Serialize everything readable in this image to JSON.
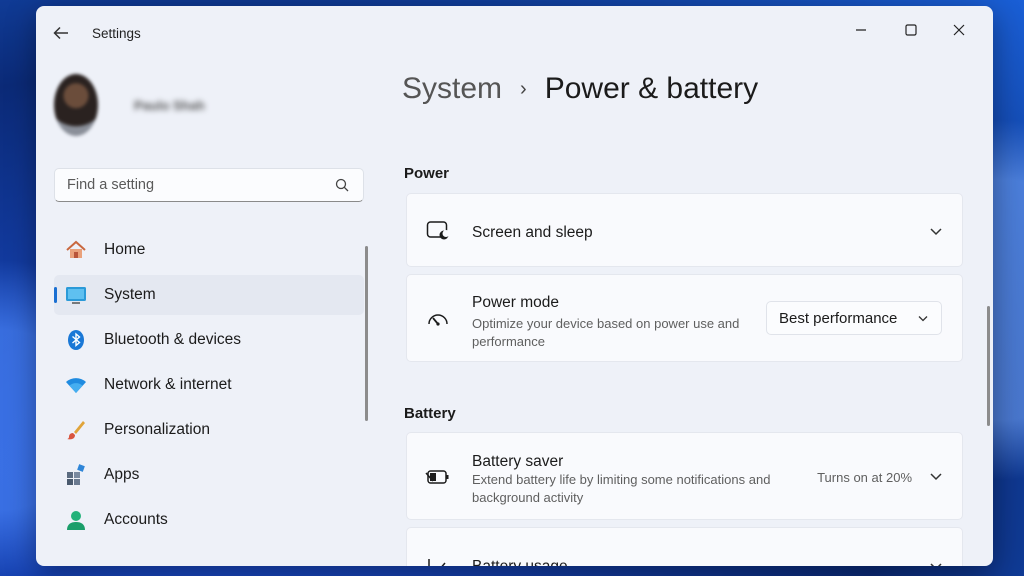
{
  "window": {
    "title": "Settings"
  },
  "profile": {
    "name": "Paulo Shah"
  },
  "search": {
    "placeholder": "Find a setting"
  },
  "nav": [
    {
      "label": "Home",
      "icon": "home-icon"
    },
    {
      "label": "System",
      "icon": "system-icon",
      "active": true
    },
    {
      "label": "Bluetooth & devices",
      "icon": "bluetooth-icon"
    },
    {
      "label": "Network & internet",
      "icon": "wifi-icon"
    },
    {
      "label": "Personalization",
      "icon": "brush-icon"
    },
    {
      "label": "Apps",
      "icon": "apps-icon"
    },
    {
      "label": "Accounts",
      "icon": "accounts-icon"
    }
  ],
  "breadcrumb": {
    "parent": "System",
    "separator": "›",
    "current": "Power & battery"
  },
  "sections": {
    "power": "Power",
    "battery": "Battery"
  },
  "cards": {
    "screen_sleep": {
      "title": "Screen and sleep"
    },
    "power_mode": {
      "title": "Power mode",
      "desc": "Optimize your device based on power use and performance",
      "value": "Best performance"
    },
    "battery_saver": {
      "title": "Battery saver",
      "desc": "Extend battery life by limiting some notifications and background activity",
      "status": "Turns on at 20%"
    },
    "battery_usage": {
      "title": "Battery usage"
    }
  },
  "colors": {
    "accent": "#1a6fd2",
    "window_bg": "#eef1f8",
    "card_bg": "#f9fafd"
  }
}
